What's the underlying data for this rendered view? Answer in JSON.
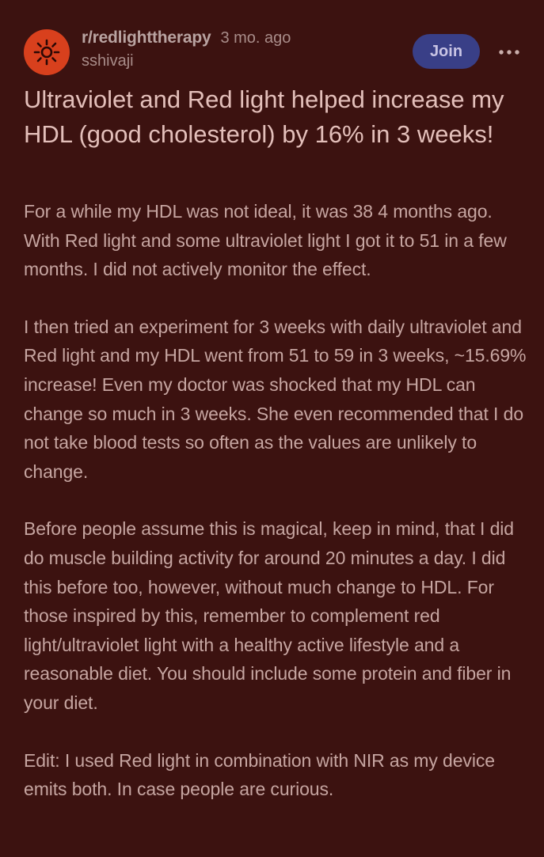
{
  "post": {
    "subreddit": "r/redlighttherapy",
    "time_ago": "3 mo. ago",
    "author": "sshivaji",
    "join_label": "Join",
    "more_icon": "more-horizontal-icon",
    "avatar_icon": "subreddit-lamp-icon",
    "title": "Ultraviolet and Red light helped increase my HDL (good cholesterol) by 16% in 3 weeks!",
    "paragraphs": [
      "For a while my HDL was not ideal, it was 38 4 months ago. With Red light and some ultraviolet light I got it to 51 in a few months. I did not actively monitor the effect.",
      "I then tried an experiment for 3 weeks with daily ultraviolet and Red light and my HDL went from 51 to 59 in 3 weeks, ~15.69% increase! Even my doctor was shocked that my HDL can change so much in 3 weeks. She even recommended that I do not take blood tests so often as the values are unlikely to change.",
      "Before people assume this is magical, keep in mind, that I did do muscle building activity for around 20 minutes a day. I did this before too, however, without much change to HDL. For those inspired by this, remember to complement red light/ultraviolet light with a healthy active lifestyle and a reasonable diet. You should include some protein and fiber in your diet.",
      "Edit: I used Red light in combination with NIR as my device emits both. In case people are curious."
    ]
  },
  "colors": {
    "background": "#3c1210",
    "avatar": "#d8401d",
    "join_button": "#393f87",
    "text": "#c6a5a1"
  }
}
